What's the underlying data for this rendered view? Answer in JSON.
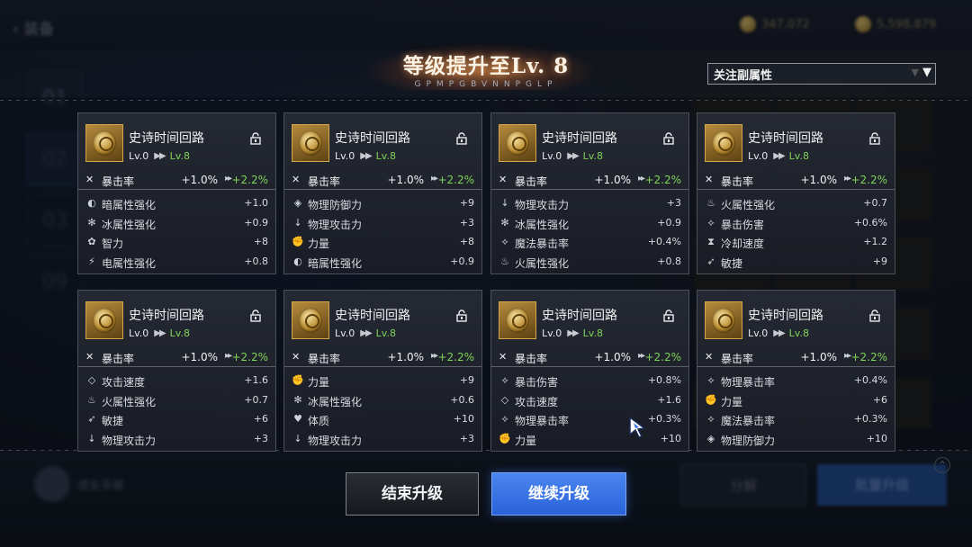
{
  "header": {
    "title": "等级提升至Lv. 8",
    "subtitle": "GPMPGBVNNPGLP"
  },
  "background": {
    "back_label": "装备",
    "currency_1": "347,072",
    "currency_2": "5,598,879",
    "tabs": [
      "01",
      "02",
      "03",
      "09"
    ],
    "avatar_label": "成长手册",
    "btn_decompose": "分解",
    "btn_batch": "批量升级"
  },
  "filter": {
    "label": "关注副属性"
  },
  "cards": [
    {
      "name": "史诗时间回路",
      "lv_from": "Lv.0",
      "lv_to": "Lv.8",
      "main": {
        "icon": "crit-icon",
        "glyph": "✕",
        "name": "暴击率",
        "value": "+1.0%",
        "new": "+2.2%"
      },
      "subs": [
        {
          "icon": "dark-attribute-icon",
          "glyph": "◐",
          "name": "暗属性强化",
          "value": "+1.0"
        },
        {
          "icon": "ice-attribute-icon",
          "glyph": "✻",
          "name": "冰属性强化",
          "value": "+0.9"
        },
        {
          "icon": "intelligence-icon",
          "glyph": "✿",
          "name": "智力",
          "value": "+8"
        },
        {
          "icon": "lightning-attribute-icon",
          "glyph": "⚡",
          "name": "电属性强化",
          "value": "+0.8"
        }
      ]
    },
    {
      "name": "史诗时间回路",
      "lv_from": "Lv.0",
      "lv_to": "Lv.8",
      "main": {
        "icon": "crit-icon",
        "glyph": "✕",
        "name": "暴击率",
        "value": "+1.0%",
        "new": "+2.2%"
      },
      "subs": [
        {
          "icon": "physical-defense-icon",
          "glyph": "◈",
          "name": "物理防御力",
          "value": "+9"
        },
        {
          "icon": "physical-attack-icon",
          "glyph": "↓",
          "name": "物理攻击力",
          "value": "+3"
        },
        {
          "icon": "strength-icon",
          "glyph": "✊",
          "name": "力量",
          "value": "+8"
        },
        {
          "icon": "dark-attribute-icon",
          "glyph": "◐",
          "name": "暗属性强化",
          "value": "+0.9"
        }
      ]
    },
    {
      "name": "史诗时间回路",
      "lv_from": "Lv.0",
      "lv_to": "Lv.8",
      "main": {
        "icon": "crit-icon",
        "glyph": "✕",
        "name": "暴击率",
        "value": "+1.0%",
        "new": "+2.2%"
      },
      "subs": [
        {
          "icon": "physical-attack-icon",
          "glyph": "↓",
          "name": "物理攻击力",
          "value": "+3"
        },
        {
          "icon": "ice-attribute-icon",
          "glyph": "✻",
          "name": "冰属性强化",
          "value": "+0.9"
        },
        {
          "icon": "magic-crit-icon",
          "glyph": "⟡",
          "name": "魔法暴击率",
          "value": "+0.4%"
        },
        {
          "icon": "fire-attribute-icon",
          "glyph": "♨",
          "name": "火属性强化",
          "value": "+0.8"
        }
      ]
    },
    {
      "name": "史诗时间回路",
      "lv_from": "Lv.0",
      "lv_to": "Lv.8",
      "main": {
        "icon": "crit-icon",
        "glyph": "✕",
        "name": "暴击率",
        "value": "+1.0%",
        "new": "+2.2%"
      },
      "subs": [
        {
          "icon": "fire-attribute-icon",
          "glyph": "♨",
          "name": "火属性强化",
          "value": "+0.7"
        },
        {
          "icon": "crit-damage-icon",
          "glyph": "⟡",
          "name": "暴击伤害",
          "value": "+0.6%"
        },
        {
          "icon": "cooldown-icon",
          "glyph": "⧗",
          "name": "冷却速度",
          "value": "+1.2"
        },
        {
          "icon": "agility-icon",
          "glyph": "➶",
          "name": "敏捷",
          "value": "+9"
        }
      ]
    },
    {
      "name": "史诗时间回路",
      "lv_from": "Lv.0",
      "lv_to": "Lv.8",
      "main": {
        "icon": "crit-icon",
        "glyph": "✕",
        "name": "暴击率",
        "value": "+1.0%",
        "new": "+2.2%"
      },
      "subs": [
        {
          "icon": "attack-speed-icon",
          "glyph": "◇",
          "name": "攻击速度",
          "value": "+1.6"
        },
        {
          "icon": "fire-attribute-icon",
          "glyph": "♨",
          "name": "火属性强化",
          "value": "+0.7"
        },
        {
          "icon": "agility-icon",
          "glyph": "➶",
          "name": "敏捷",
          "value": "+6"
        },
        {
          "icon": "physical-attack-icon",
          "glyph": "↓",
          "name": "物理攻击力",
          "value": "+3"
        }
      ]
    },
    {
      "name": "史诗时间回路",
      "lv_from": "Lv.0",
      "lv_to": "Lv.8",
      "main": {
        "icon": "crit-icon",
        "glyph": "✕",
        "name": "暴击率",
        "value": "+1.0%",
        "new": "+2.2%"
      },
      "subs": [
        {
          "icon": "strength-icon",
          "glyph": "✊",
          "name": "力量",
          "value": "+9"
        },
        {
          "icon": "ice-attribute-icon",
          "glyph": "✻",
          "name": "冰属性强化",
          "value": "+0.6"
        },
        {
          "icon": "vitality-icon",
          "glyph": "♥",
          "name": "体质",
          "value": "+10"
        },
        {
          "icon": "physical-attack-icon",
          "glyph": "↓",
          "name": "物理攻击力",
          "value": "+3"
        }
      ]
    },
    {
      "name": "史诗时间回路",
      "lv_from": "Lv.0",
      "lv_to": "Lv.8",
      "main": {
        "icon": "crit-icon",
        "glyph": "✕",
        "name": "暴击率",
        "value": "+1.0%",
        "new": "+2.2%"
      },
      "subs": [
        {
          "icon": "crit-damage-icon",
          "glyph": "⟡",
          "name": "暴击伤害",
          "value": "+0.8%"
        },
        {
          "icon": "attack-speed-icon",
          "glyph": "◇",
          "name": "攻击速度",
          "value": "+1.6"
        },
        {
          "icon": "physical-crit-icon",
          "glyph": "⟡",
          "name": "物理暴击率",
          "value": "+0.3%"
        },
        {
          "icon": "strength-icon",
          "glyph": "✊",
          "name": "力量",
          "value": "+10"
        }
      ]
    },
    {
      "name": "史诗时间回路",
      "lv_from": "Lv.0",
      "lv_to": "Lv.8",
      "main": {
        "icon": "crit-icon",
        "glyph": "✕",
        "name": "暴击率",
        "value": "+1.0%",
        "new": "+2.2%"
      },
      "subs": [
        {
          "icon": "physical-crit-icon",
          "glyph": "⟡",
          "name": "物理暴击率",
          "value": "+0.4%"
        },
        {
          "icon": "strength-icon",
          "glyph": "✊",
          "name": "力量",
          "value": "+6"
        },
        {
          "icon": "magic-crit-icon",
          "glyph": "⟡",
          "name": "魔法暴击率",
          "value": "+0.3%"
        },
        {
          "icon": "physical-defense-icon",
          "glyph": "◈",
          "name": "物理防御力",
          "value": "+10"
        }
      ]
    }
  ],
  "buttons": {
    "end_label": "结束升级",
    "continue_label": "继续升级"
  },
  "colors": {
    "accent_blue": "#3a74e8",
    "increase_green": "#7fd35a",
    "card_border": "#4b505b"
  }
}
